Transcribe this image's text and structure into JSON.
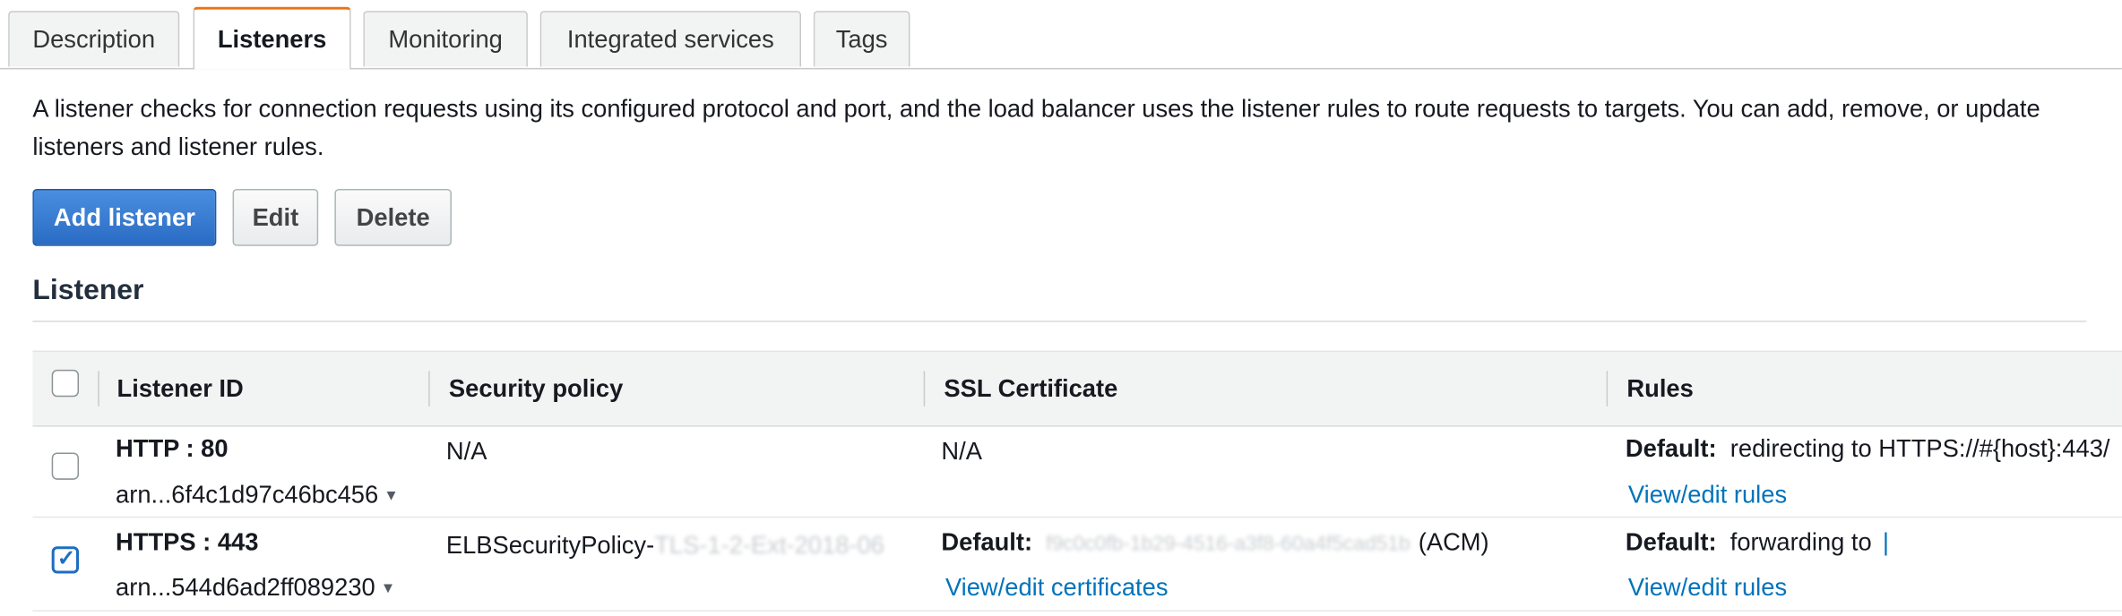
{
  "tabs": [
    "Description",
    "Listeners",
    "Monitoring",
    "Integrated services",
    "Tags"
  ],
  "description_text": "A listener checks for connection requests using its configured protocol and port, and the load balancer uses the listener rules to route requests to targets. You can add, remove, or update listeners and listener rules.",
  "buttons": {
    "add": "Add listener",
    "edit": "Edit",
    "delete": "Delete"
  },
  "section_title": "Listener",
  "table": {
    "headers": {
      "id": "Listener ID",
      "policy": "Security policy",
      "cert": "SSL Certificate",
      "rules": "Rules"
    },
    "rows": [
      {
        "protocol_port": "HTTP : 80",
        "arn": "arn...6f4c1d97c46bc456",
        "policy": "N/A",
        "cert": "N/A",
        "rules_label": "Default:",
        "rules_value": "redirecting to HTTPS://#{host}:443/",
        "rules_link": "View/edit rules",
        "checked": false
      },
      {
        "protocol_port": "HTTPS : 443",
        "arn": "arn...544d6ad2ff089230",
        "policy": "ELBSecurityPolicy-",
        "policy_obscured": "TLS-1-2-Ext-2018-06",
        "cert_label": "Default:",
        "cert_obscured": "f9c0c0fb-1b29-4516-a3f8-60a4f5cad51b",
        "cert_suffix": "(ACM)",
        "cert_link": "View/edit certificates",
        "rules_label": "Default:",
        "rules_value": "forwarding to",
        "rules_link": "View/edit rules",
        "checked": true
      }
    ]
  }
}
